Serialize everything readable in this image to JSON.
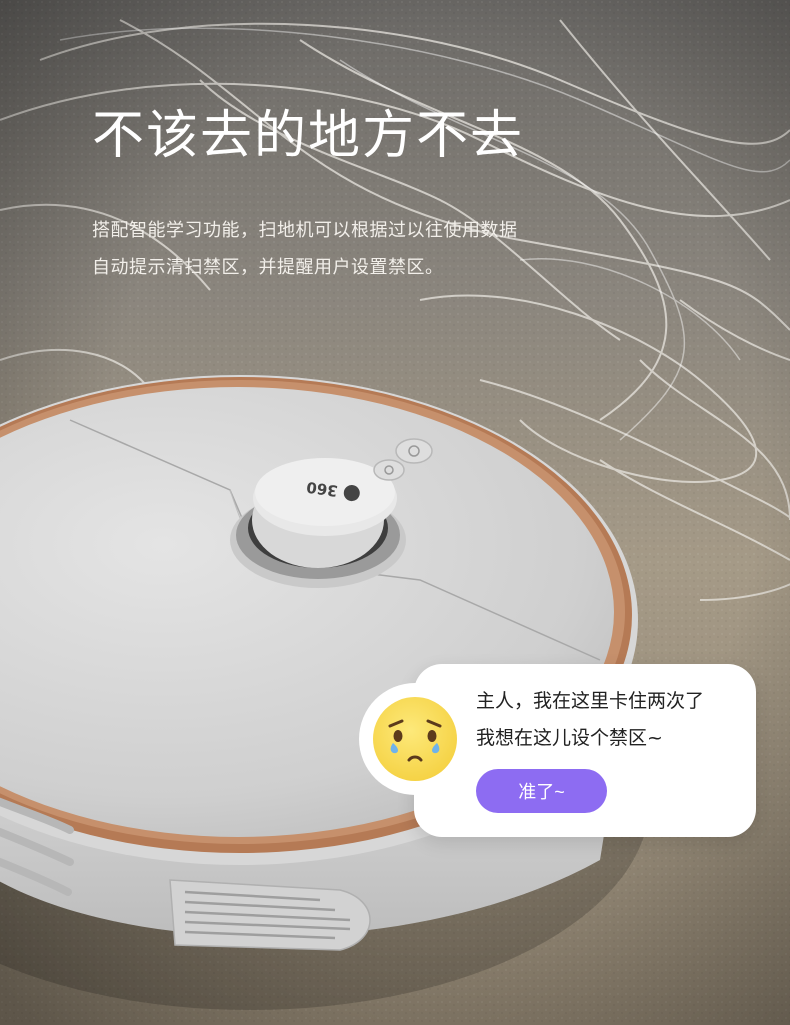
{
  "hero": {
    "title": "不该去的地方不去",
    "description_line1": "搭配智能学习功能，扫地机可以根据过以往使用数据",
    "description_line2": "自动提示清扫禁区，并提醒用户设置禁区。"
  },
  "robot": {
    "brand_logo": "360"
  },
  "chat_bubble": {
    "message_line1": "主人，我在这里卡住两次了",
    "message_line2": "我想在这儿设个禁区~",
    "button_label": "准了~",
    "emoji": "sad-crying-face-icon",
    "button_color": "#8d6cf2",
    "emoji_color": "#fbe36a"
  },
  "colors": {
    "robot_body": "#d9d9d9",
    "copper_ring": "#b57a55",
    "carpet": "#b8ab96"
  }
}
